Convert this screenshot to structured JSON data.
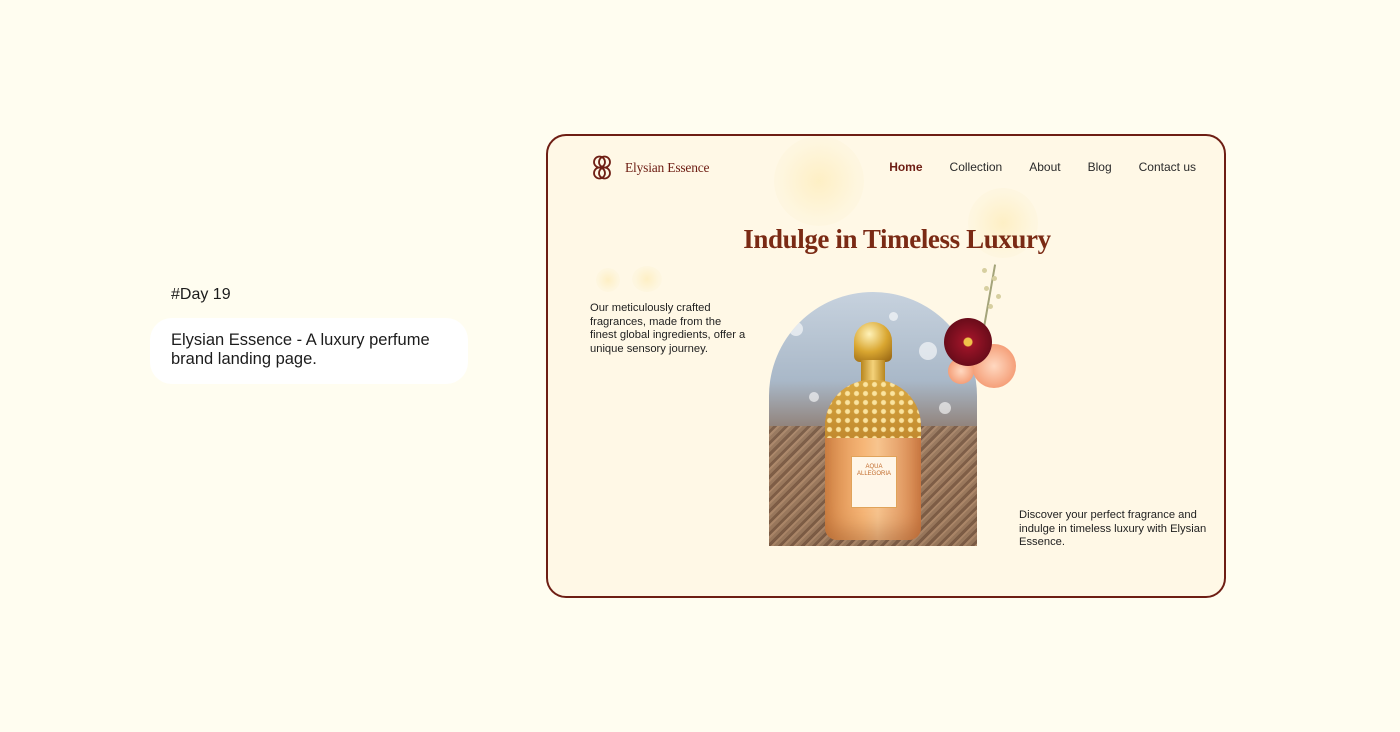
{
  "intro": {
    "day": "#Day 19",
    "description": "Elysian Essence - A luxury perfume brand landing page."
  },
  "site": {
    "brand": "Elysian Essence",
    "nav": [
      {
        "label": "Home",
        "active": true
      },
      {
        "label": "Collection",
        "active": false
      },
      {
        "label": "About",
        "active": false
      },
      {
        "label": "Blog",
        "active": false
      },
      {
        "label": "Contact us",
        "active": false
      }
    ],
    "hero_title": "Indulge in Timeless Luxury",
    "left_copy": "Our meticulously crafted fragrances, made from the finest global ingredients, offer a unique sensory journey.",
    "right_copy": "Discover your perfect fragrance and  indulge in timeless luxury with Elysian Essence.",
    "product_label": "AQUA ALLEGORIA"
  },
  "colors": {
    "page_background": "#fffdf0",
    "card_background": "#fff8e6",
    "brand_brown": "#6e1e14",
    "title_brown": "#7a2a14"
  },
  "icons": {
    "logo": "interlaced-knot-logo-icon"
  }
}
